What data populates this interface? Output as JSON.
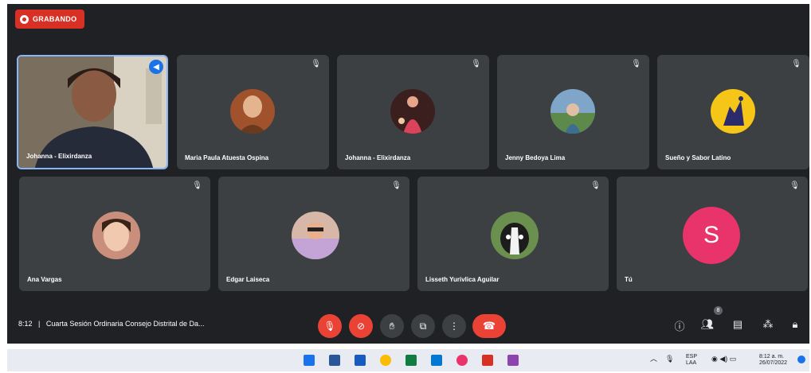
{
  "recording_label": "GRABANDO",
  "participants_row1": [
    {
      "name": "Johanna - Elixirdanza",
      "type": "video",
      "speaking": true
    },
    {
      "name": "Maria Paula Atuesta Ospina",
      "type": "avatar",
      "avatar_color": "#a0522d"
    },
    {
      "name": "Johanna - Elixirdanza",
      "type": "avatar",
      "avatar_color": "#3b1f1f"
    },
    {
      "name": "Jenny Bedoya Lima",
      "type": "avatar",
      "avatar_color": "#7fa6c9"
    },
    {
      "name": "Sueño y Sabor Latino",
      "type": "avatar",
      "avatar_color": "#f5c518"
    }
  ],
  "participants_row2": [
    {
      "name": "Ana Vargas",
      "type": "avatar",
      "avatar_color": "#c98f7c"
    },
    {
      "name": "Edgar Laiseca",
      "type": "avatar",
      "avatar_color": "#d7b8a8"
    },
    {
      "name": "Lisseth Yurivlica Aguilar",
      "type": "avatar",
      "avatar_color": "#6b8f4e"
    },
    {
      "name": "Tú",
      "type": "initial",
      "initial": "S",
      "avatar_color": "#e8336b"
    }
  ],
  "meeting": {
    "time": "8:12",
    "separator": "|",
    "title": "Cuarta Sesión Ordinaria Consejo Distrital de Da..."
  },
  "controls": {
    "more_symbol": "⋮",
    "participants_count": "8"
  },
  "taskbar": {
    "lang_top": "ESP",
    "lang_bottom": "LAA",
    "clock_time": "8:12 a. m.",
    "clock_date": "26/07/2022"
  },
  "colors": {
    "meet_bg": "#202124",
    "tile_bg": "#3c4043",
    "accent_red": "#ea4335",
    "speaking_border": "#8ab4f8"
  }
}
